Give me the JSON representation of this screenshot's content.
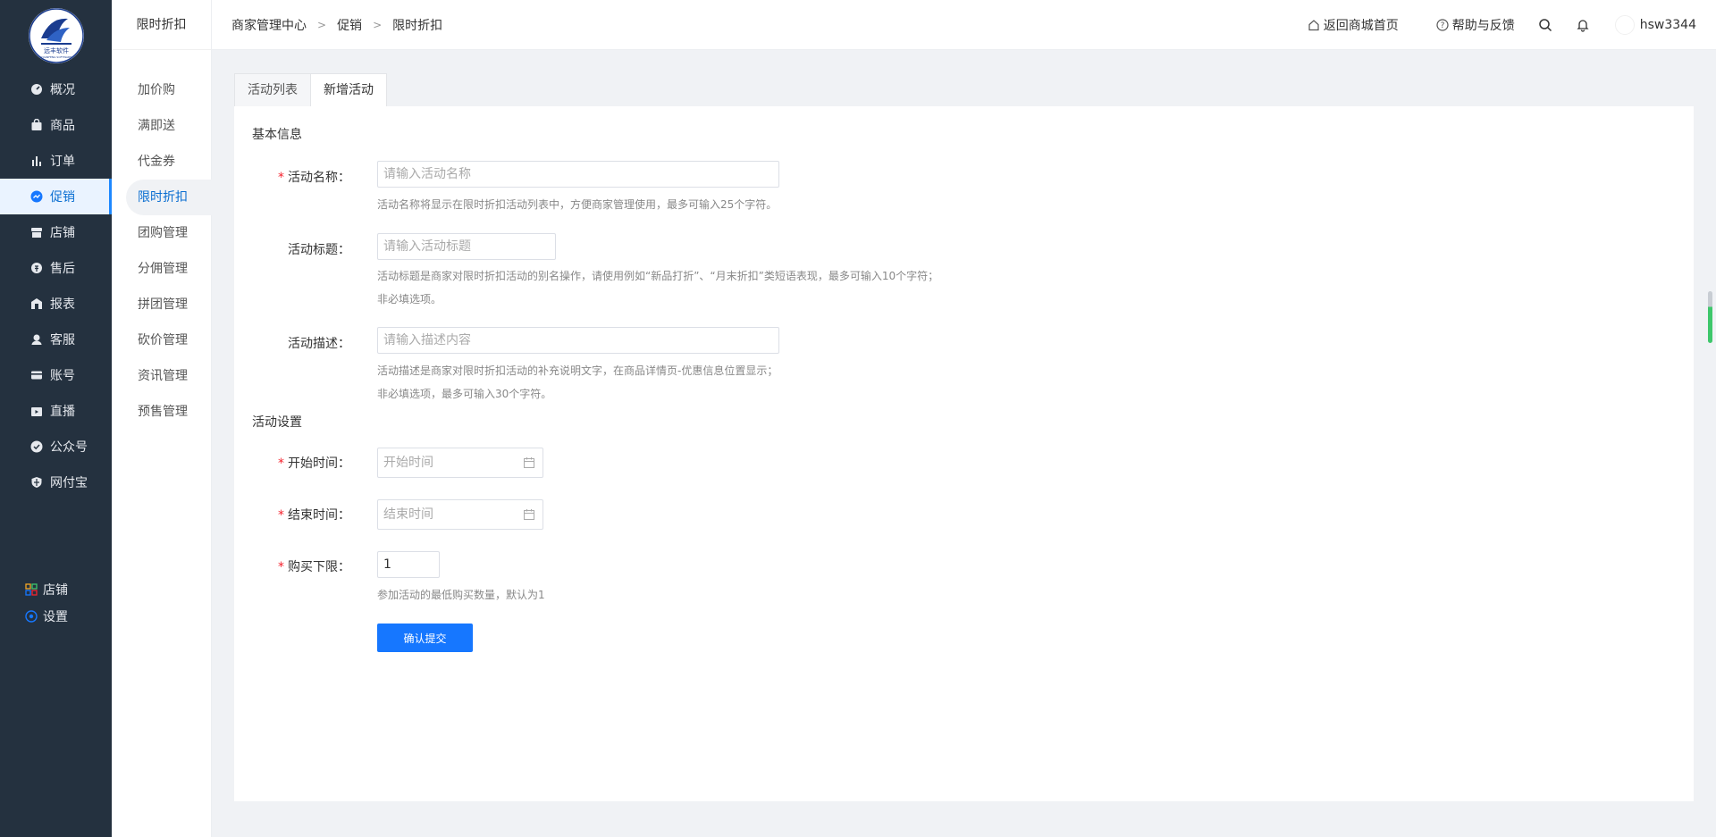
{
  "logo": {
    "text": "远丰软件",
    "subtext": "YUANFENG SOFTWARE"
  },
  "nav_primary": [
    {
      "label": "概况",
      "icon": "dashboard-icon"
    },
    {
      "label": "商品",
      "icon": "bag-icon"
    },
    {
      "label": "订单",
      "icon": "bar-chart-icon"
    },
    {
      "label": "促销",
      "icon": "promo-icon"
    },
    {
      "label": "店铺",
      "icon": "store-icon"
    },
    {
      "label": "售后",
      "icon": "after-sale-icon"
    },
    {
      "label": "报表",
      "icon": "report-icon"
    },
    {
      "label": "客服",
      "icon": "customer-service-icon"
    },
    {
      "label": "账号",
      "icon": "card-icon"
    },
    {
      "label": "直播",
      "icon": "live-icon"
    },
    {
      "label": "公众号",
      "icon": "check-badge-icon"
    },
    {
      "label": "网付宝",
      "icon": "shield-icon"
    }
  ],
  "nav_bottom": [
    {
      "label": "店铺",
      "icon": "grid-icon"
    },
    {
      "label": "设置",
      "icon": "settings-icon"
    }
  ],
  "nav_secondary": {
    "title": "限时折扣",
    "items": [
      "加价购",
      "满即送",
      "代金券",
      "限时折扣",
      "团购管理",
      "分佣管理",
      "拼团管理",
      "砍价管理",
      "资讯管理",
      "预售管理"
    ]
  },
  "breadcrumb": [
    "商家管理中心",
    "促销",
    "限时折扣"
  ],
  "header": {
    "home_link": "返回商城首页",
    "help_link": "帮助与反馈",
    "username": "hsw3344"
  },
  "tabs": [
    "活动列表",
    "新增活动"
  ],
  "form": {
    "section_basic": "基本信息",
    "name_label": "活动名称：",
    "name_placeholder": "请输入活动名称",
    "name_hint": "活动名称将显示在限时折扣活动列表中，方便商家管理使用，最多可输入25个字符。",
    "title_label": "活动标题：",
    "title_placeholder": "请输入活动标题",
    "title_hint_1": "活动标题是商家对限时折扣活动的别名操作，请使用例如“新品打折”、“月末折扣”类短语表现，最多可输入10个字符；",
    "title_hint_2": "非必填选项。",
    "desc_label": "活动描述：",
    "desc_placeholder": "请输入描述内容",
    "desc_hint_1": "活动描述是商家对限时折扣活动的补充说明文字，在商品详情页-优惠信息位置显示；",
    "desc_hint_2": "非必填选项，最多可输入30个字符。",
    "section_settings": "活动设置",
    "start_label": "开始时间：",
    "start_placeholder": "开始时间",
    "end_label": "结束时间：",
    "end_placeholder": "结束时间",
    "min_label": "购买下限：",
    "min_value": "1",
    "min_hint": "参加活动的最低购买数量，默认为1",
    "submit": "确认提交"
  },
  "colors": {
    "accent": "#1677ff",
    "sidebar": "#24313f",
    "required": "#f5222d"
  }
}
